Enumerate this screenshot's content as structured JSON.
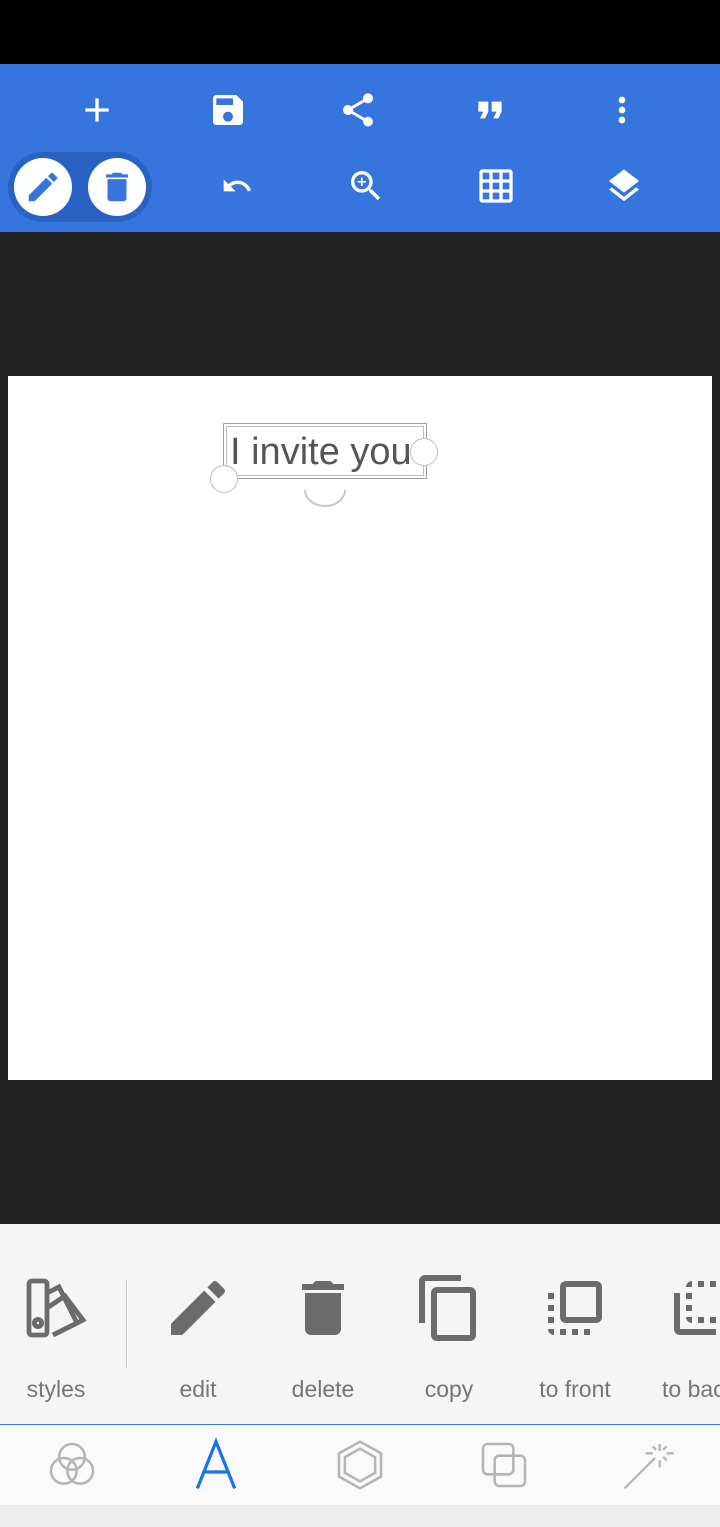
{
  "canvas": {
    "text_object": {
      "text": "I invite you"
    }
  },
  "bottom_tools": [
    {
      "label": "styles",
      "icon": "styles-swatch-icon"
    },
    {
      "label": "edit",
      "icon": "pencil-icon"
    },
    {
      "label": "delete",
      "icon": "trash-icon"
    },
    {
      "label": "copy",
      "icon": "copy-icon"
    },
    {
      "label": "to front",
      "icon": "bring-to-front-icon"
    },
    {
      "label": "to bac",
      "icon": "send-to-back-icon"
    }
  ],
  "tabs": [
    {
      "icon": "color-circles-icon",
      "active": false
    },
    {
      "icon": "text-a-icon",
      "active": true
    },
    {
      "icon": "shape-hexagon-icon",
      "active": false
    },
    {
      "icon": "layers-squares-icon",
      "active": false
    },
    {
      "icon": "magic-wand-icon",
      "active": false
    }
  ],
  "colors": {
    "toolbar": "#3575dd",
    "accent": "#1a73e8",
    "canvas_bg": "#212121"
  }
}
